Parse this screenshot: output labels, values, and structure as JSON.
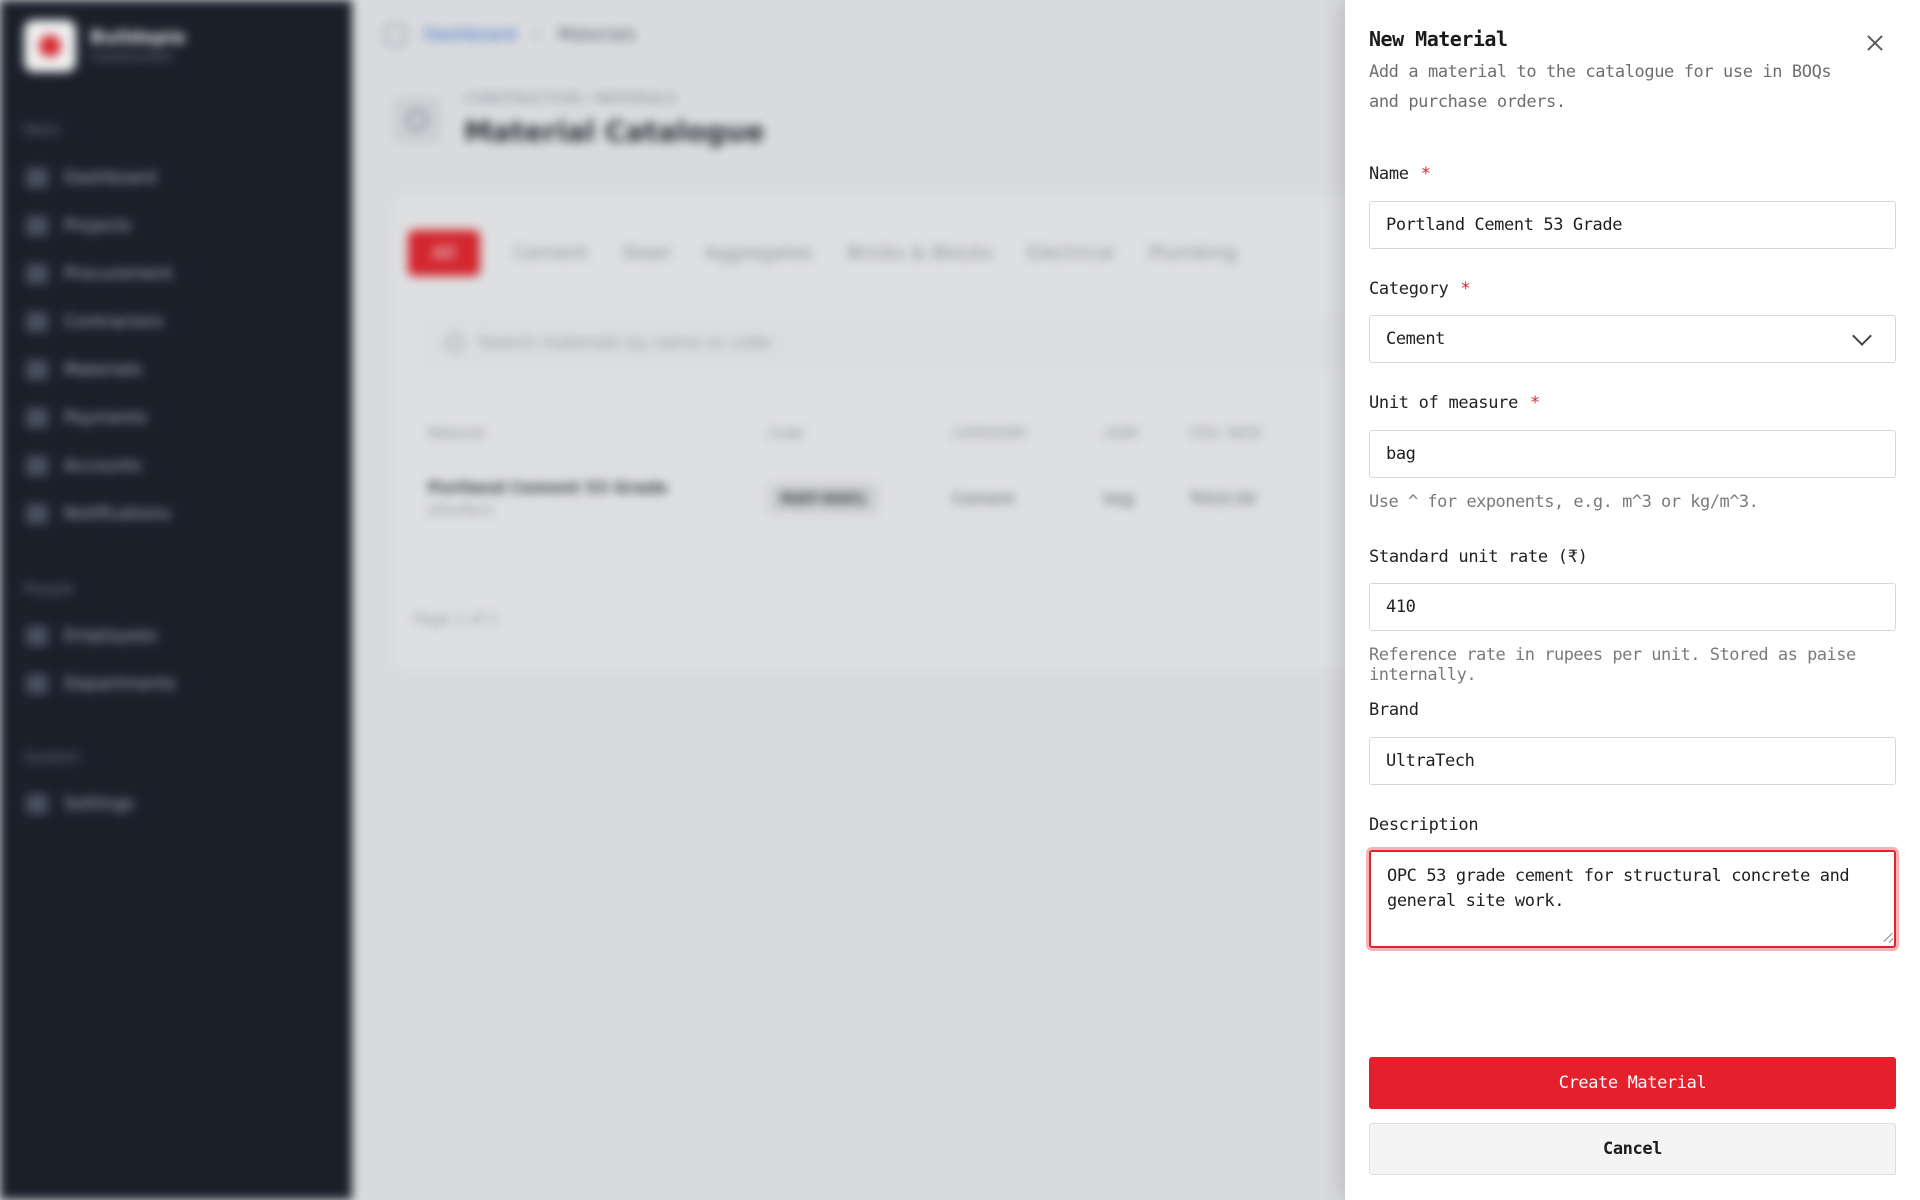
{
  "background": {
    "brand": {
      "name": "Buildopia",
      "subtitle": "Construction"
    },
    "nav_sections": [
      "Main",
      "People",
      "System"
    ],
    "nav_items": [
      "Dashboard",
      "Projects",
      "Procurement",
      "Contractors",
      "Materials",
      "Payments",
      "Accounts",
      "Notifications",
      "Employees",
      "Departments",
      "Settings"
    ],
    "breadcrumb": {
      "home": "Dashboard",
      "separator": "/",
      "current": "Materials"
    },
    "page": {
      "kicker": "CONSTRUCTION / MATERIALS",
      "title": "Material Catalogue"
    },
    "tabs": [
      "All",
      "Cement",
      "Steel",
      "Aggregates",
      "Bricks & Blocks",
      "Electrical",
      "Plumbing"
    ],
    "search_placeholder": "Search materials by name or code",
    "table": {
      "headers": [
        "Material",
        "Code",
        "CATEGORY",
        "UOM",
        "STD. RATE"
      ],
      "rows": [
        {
          "name": "Portland Cement 53 Grade",
          "brand": "UltraTech",
          "code": "MAT-0001",
          "category": "Cement",
          "uom": "bag",
          "rate": "₹410.00"
        }
      ]
    },
    "pager": "Page 1 of 1"
  },
  "drawer": {
    "title": "New Material",
    "description": "Add a material to the catalogue for use in BOQs and purchase orders.",
    "required_mark": "*",
    "fields": {
      "name": {
        "label": "Name",
        "value": "Portland Cement 53 Grade"
      },
      "category": {
        "label": "Category",
        "value": "Cement"
      },
      "uom": {
        "label": "Unit of measure",
        "value": "bag",
        "help": "Use ^ for exponents, e.g. m^3 or kg/m^3."
      },
      "rate": {
        "label": "Standard unit rate (₹)",
        "value": "410",
        "help": "Reference rate in rupees per unit. Stored as paise internally."
      },
      "brand": {
        "label": "Brand",
        "value": "UltraTech"
      },
      "description": {
        "label": "Description",
        "value": "OPC 53 grade cement for structural concrete and general site work."
      }
    },
    "buttons": {
      "create": "Create Material",
      "cancel": "Cancel"
    }
  },
  "colors": {
    "accent": "#e3202b",
    "sidebar": "#181c28",
    "focus_ring": "#e0242d"
  }
}
